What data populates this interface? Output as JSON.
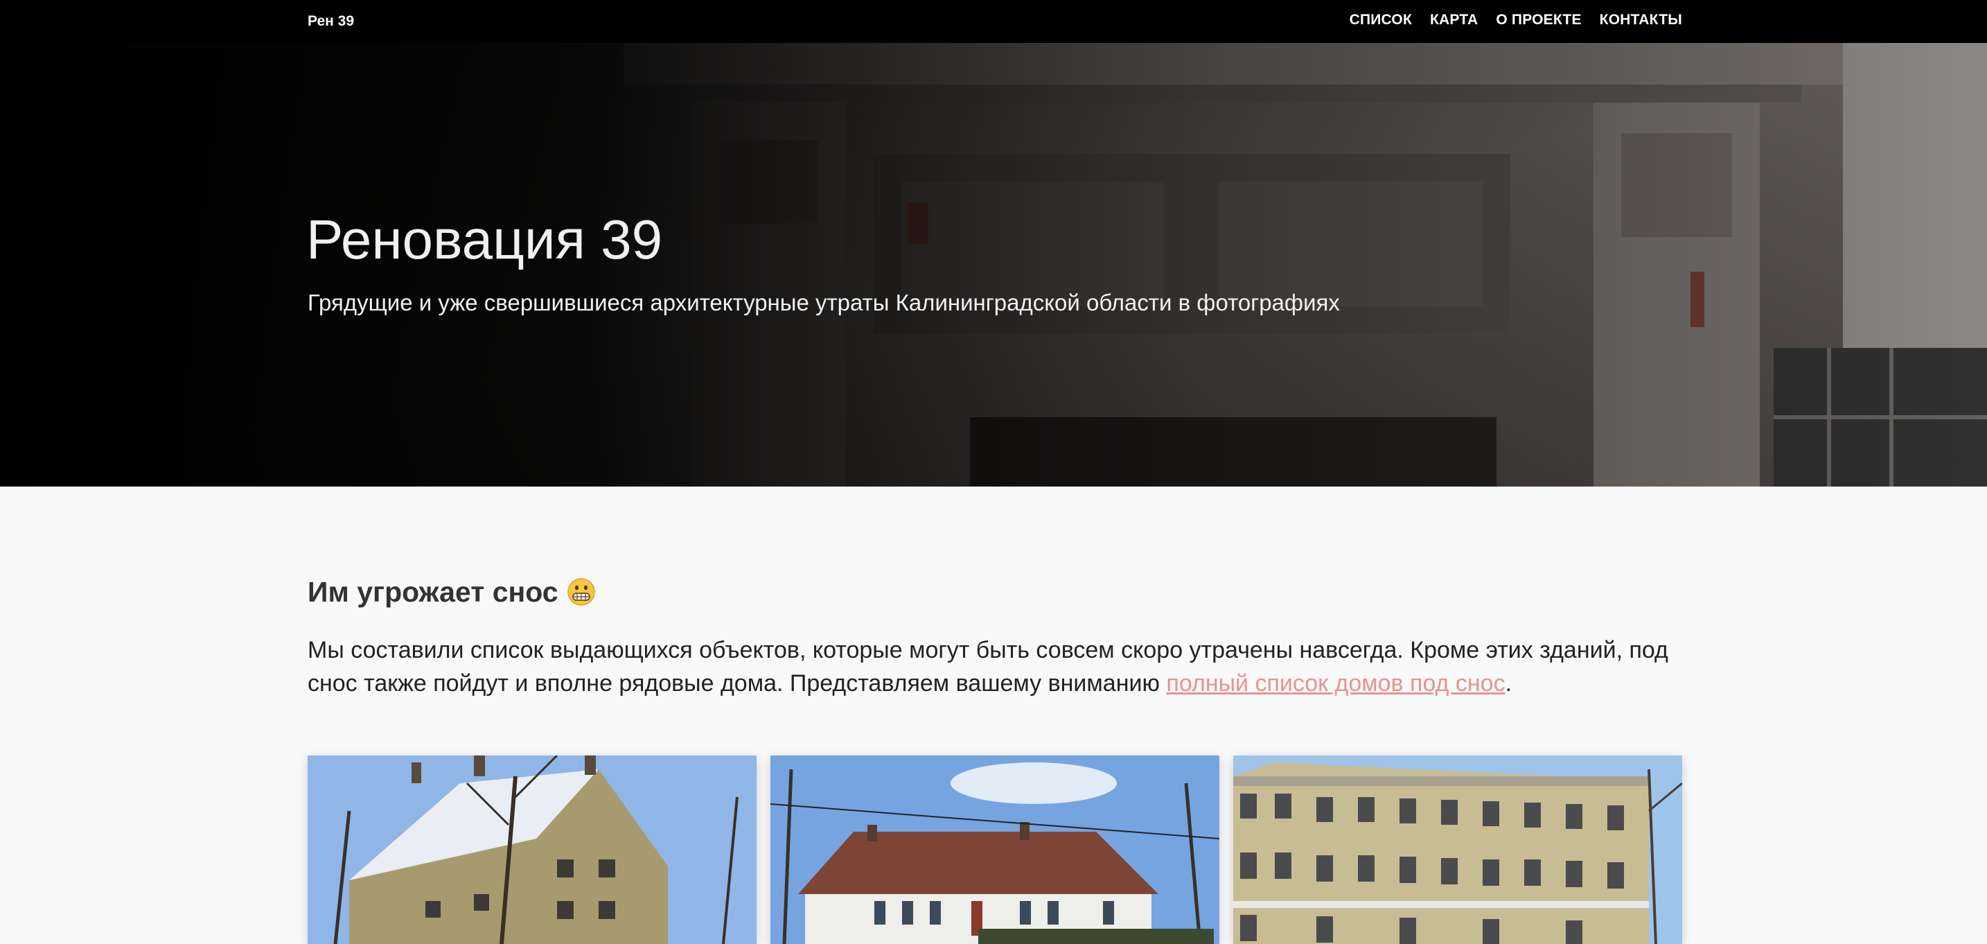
{
  "navbar": {
    "brand": "Рен 39",
    "links": [
      "Список",
      "Карта",
      "О проекте",
      "Контакты"
    ]
  },
  "hero": {
    "title": "Реновация 39",
    "subtitle": "Грядущие и уже свершившиеся архитектурные утраты Калининградской области в фотографиях"
  },
  "section": {
    "heading": "Им угрожает снос",
    "heading_icon": "grimacing-face-emoji",
    "lead_text": "Мы составили список выдающихся объектов, которые могут быть совсем скоро утрачены навсегда. Кроме этих зданий, под снос также пойдут и вполне рядовые дома. Представляем вашему вниманию ",
    "lead_link": "полный список домов под снос",
    "lead_end": "."
  },
  "cards": [
    {
      "icon": "building-photo"
    },
    {
      "icon": "building-photo"
    },
    {
      "icon": "building-photo"
    }
  ],
  "colors": {
    "nav_bg": "#000000",
    "link": "#e8938e",
    "page_bg": "#f9f9f9"
  }
}
